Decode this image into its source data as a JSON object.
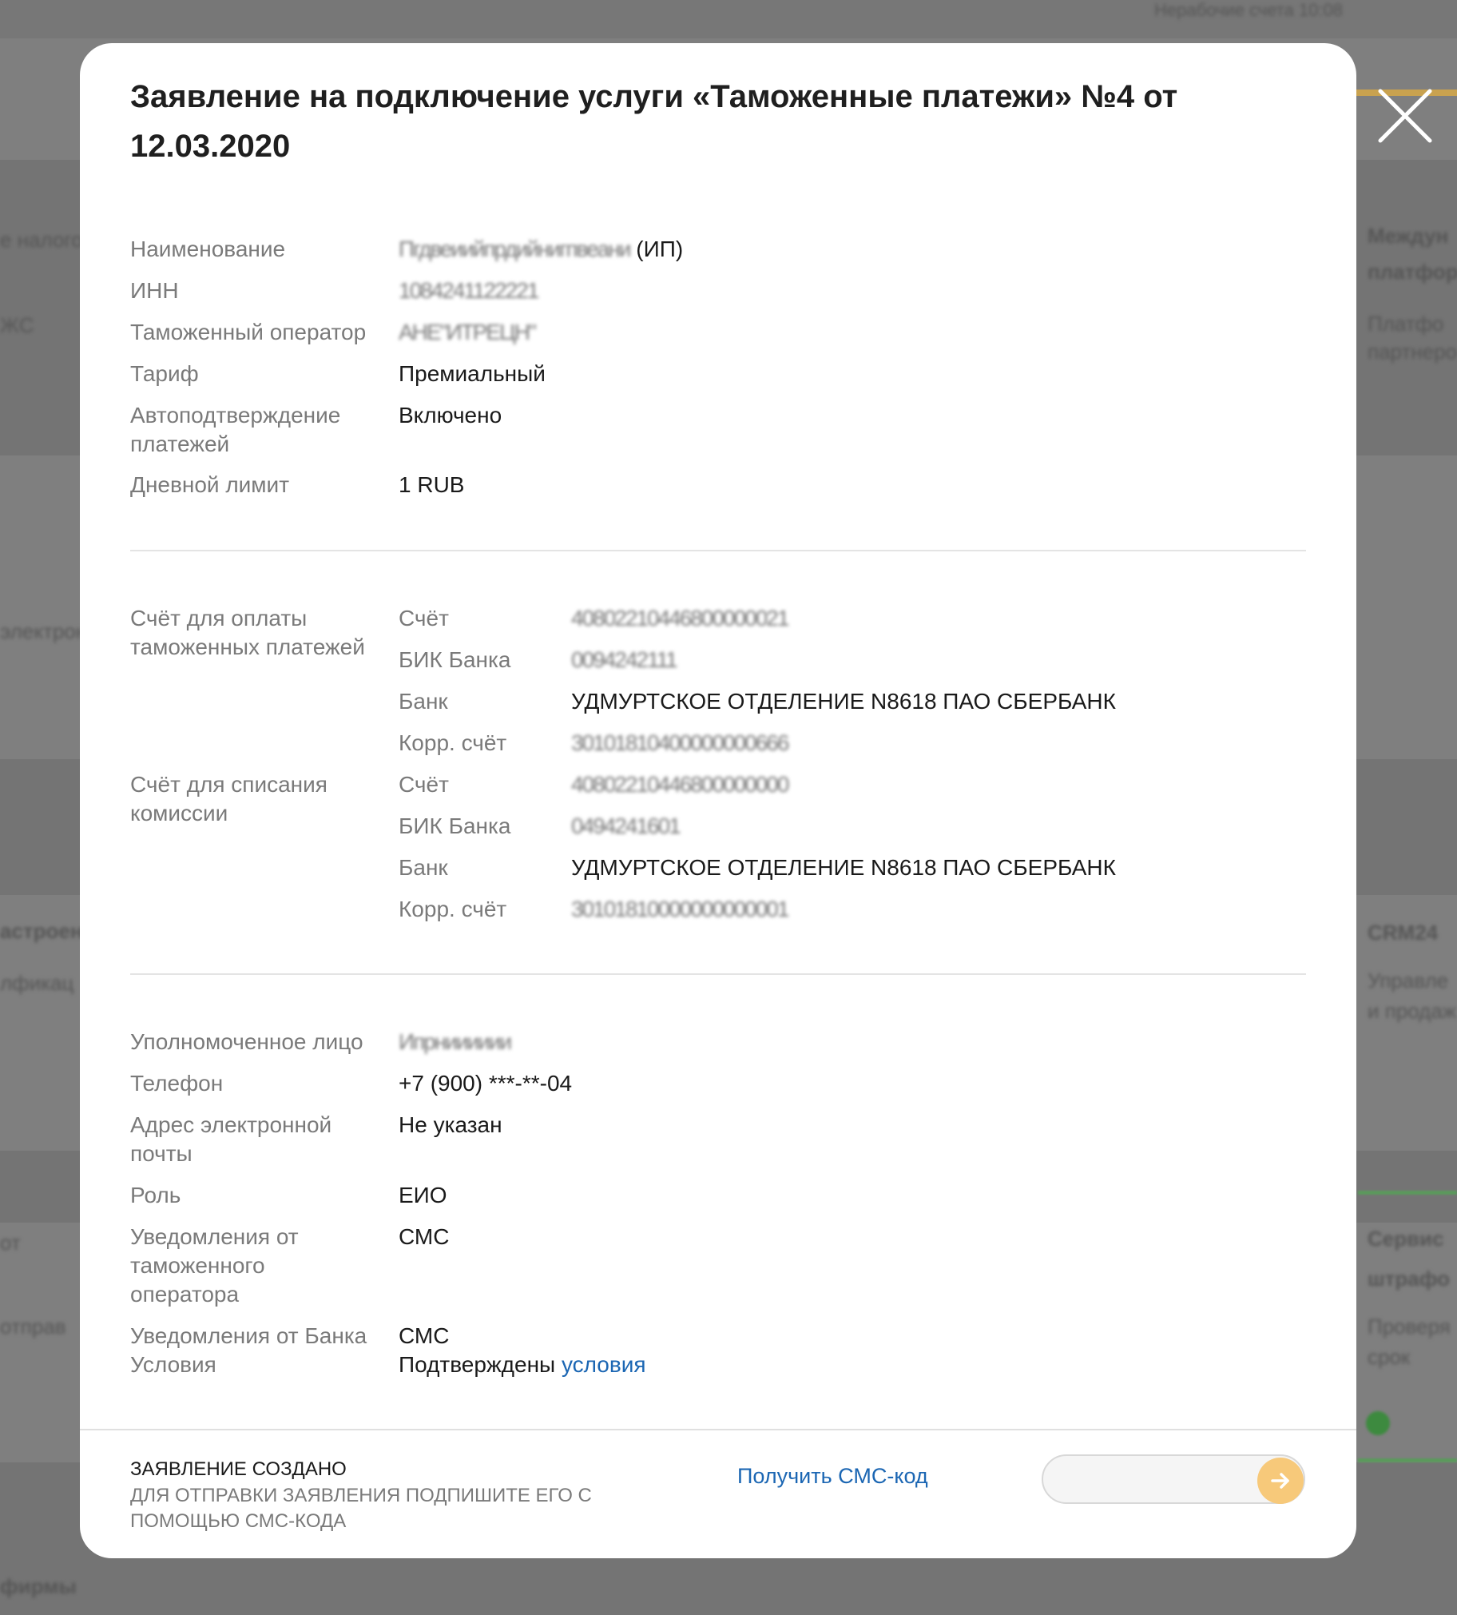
{
  "modal": {
    "title": "Заявление на подключение услуги «Таможенные платежи» №4 от 12.03.2020",
    "section1": {
      "name_label": "Наименование",
      "name_blurred": "Пгдвеиийпрдийнигпвеани",
      "name_suffix": " (ИП)",
      "inn_label": "ИНН",
      "inn_blurred": "1084241122221",
      "operator_label": "Таможенный оператор",
      "operator_blurred": "АНЕ\"ИТРЕЦН\"",
      "tariff_label": "Тариф",
      "tariff_value": "Премиальный",
      "autoconfirm_label": "Автоподтверждение платежей",
      "autoconfirm_value": "Включено",
      "limit_label": "Дневной лимит",
      "limit_value": "1 RUB"
    },
    "section2": {
      "pay_account_label": "Счёт для оплаты таможенных платежей",
      "commission_account_label": "Счёт для списания комиссии",
      "account_label": "Счёт",
      "bik_label": "БИК Банка",
      "bank_label": "Банк",
      "corr_label": "Корр. счёт",
      "pay_account_blurred": "40802210446800000021",
      "pay_bik_blurred": "0094242111",
      "pay_bank_value": "УДМУРТСКОЕ ОТДЕЛЕНИЕ N8618 ПАО СБЕРБАНК",
      "pay_corr_blurred": "30101810400000000666",
      "comm_account_blurred": "40802210446800000000",
      "comm_bik_blurred": "0494241601",
      "comm_bank_value": "УДМУРТСКОЕ ОТДЕЛЕНИЕ N8618 ПАО СБЕРБАНК",
      "comm_corr_blurred": "30101810000000000001"
    },
    "section3": {
      "person_label": "Уполномоченное лицо",
      "person_blurred": "Ипрнииииии",
      "phone_label": "Телефон",
      "phone_value": "+7 (900) ***-**-04",
      "email_label": "Адрес электронной почты",
      "email_value": "Не указан",
      "role_label": "Роль",
      "role_value": "ЕИО",
      "operator_notify_label": "Уведомления от таможенного оператора",
      "operator_notify_value": "СМС",
      "bank_notify_label": "Уведомления от Банка",
      "bank_notify_value": "СМС",
      "terms_label": "Условия",
      "terms_value": "Подтверждены",
      "terms_link": "условия"
    },
    "footer": {
      "status_title": "ЗАЯВЛЕНИЕ СОЗДАНО",
      "status_hint": "ДЛЯ ОТПРАВКИ ЗАЯВЛЕНИЯ ПОДПИШИТЕ ЕГО С ПОМОЩЬЮ СМС-КОДА",
      "get_sms_label": "Получить СМС-код",
      "sms_input_value": ""
    }
  },
  "colors": {
    "link": "#1b66b3",
    "send_button": "#f7c97a",
    "overlay": "#7f7f7f"
  },
  "icons": [
    "close-icon",
    "arrow-right-icon"
  ]
}
